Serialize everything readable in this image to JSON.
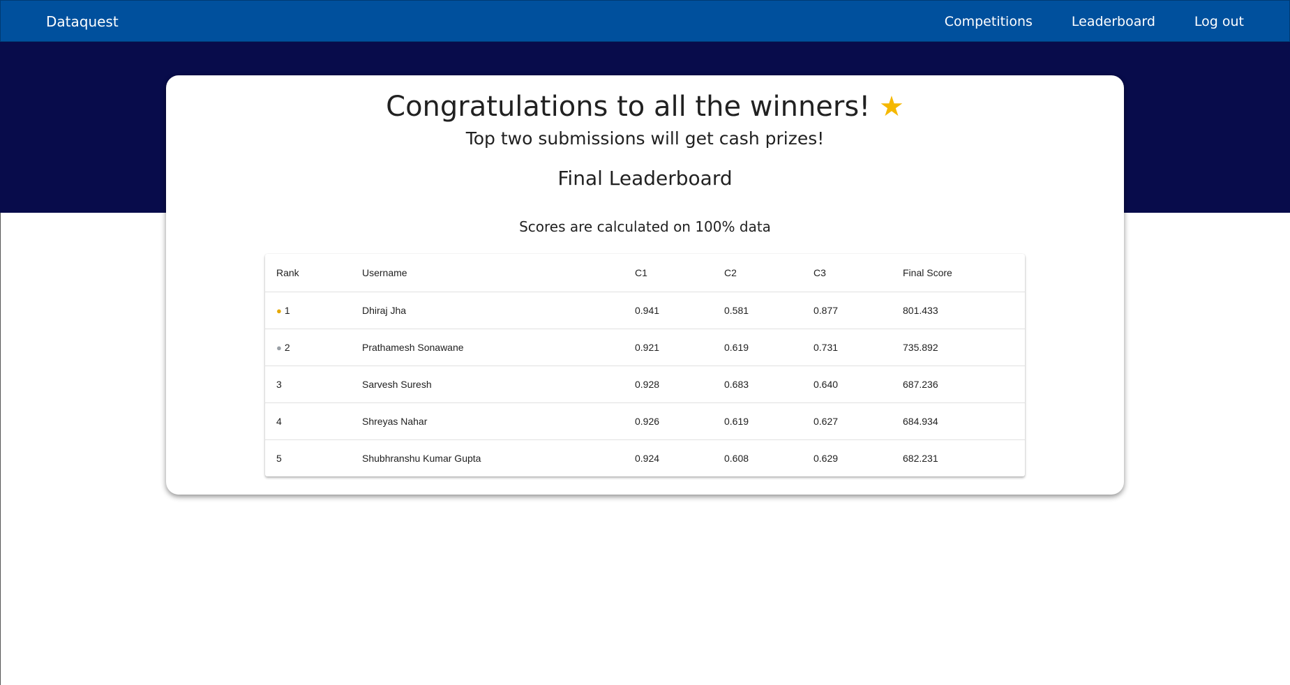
{
  "nav": {
    "brand": "Dataquest",
    "links": [
      "Competitions",
      "Leaderboard",
      "Log out"
    ]
  },
  "header": {
    "title": "Congratulations to all the winners!",
    "title_icon": "star-emoji",
    "subtitle": "Top two submissions will get cash prizes!",
    "leaderboard_title": "Final Leaderboard",
    "note": "Scores are calculated on 100% data"
  },
  "table": {
    "columns": [
      "Rank",
      "Username",
      "C1",
      "C2",
      "C3",
      "Final Score"
    ],
    "rows": [
      {
        "medal": "gold-medal-icon",
        "rank": "1",
        "username": "Dhiraj Jha",
        "c1": "0.941",
        "c2": "0.581",
        "c3": "0.877",
        "final": "801.433"
      },
      {
        "medal": "silver-medal-icon",
        "rank": "2",
        "username": "Prathamesh Sonawane",
        "c1": "0.921",
        "c2": "0.619",
        "c3": "0.731",
        "final": "735.892"
      },
      {
        "medal": "",
        "rank": "3",
        "username": "Sarvesh Suresh",
        "c1": "0.928",
        "c2": "0.683",
        "c3": "0.640",
        "final": "687.236"
      },
      {
        "medal": "",
        "rank": "4",
        "username": "Shreyas Nahar",
        "c1": "0.926",
        "c2": "0.619",
        "c3": "0.627",
        "final": "684.934"
      },
      {
        "medal": "",
        "rank": "5",
        "username": "Shubhranshu Kumar Gupta",
        "c1": "0.924",
        "c2": "0.608",
        "c3": "0.629",
        "final": "682.231"
      }
    ]
  },
  "colors": {
    "navbar": "#00509d",
    "hero": "#080c4b",
    "card": "#ffffff"
  }
}
